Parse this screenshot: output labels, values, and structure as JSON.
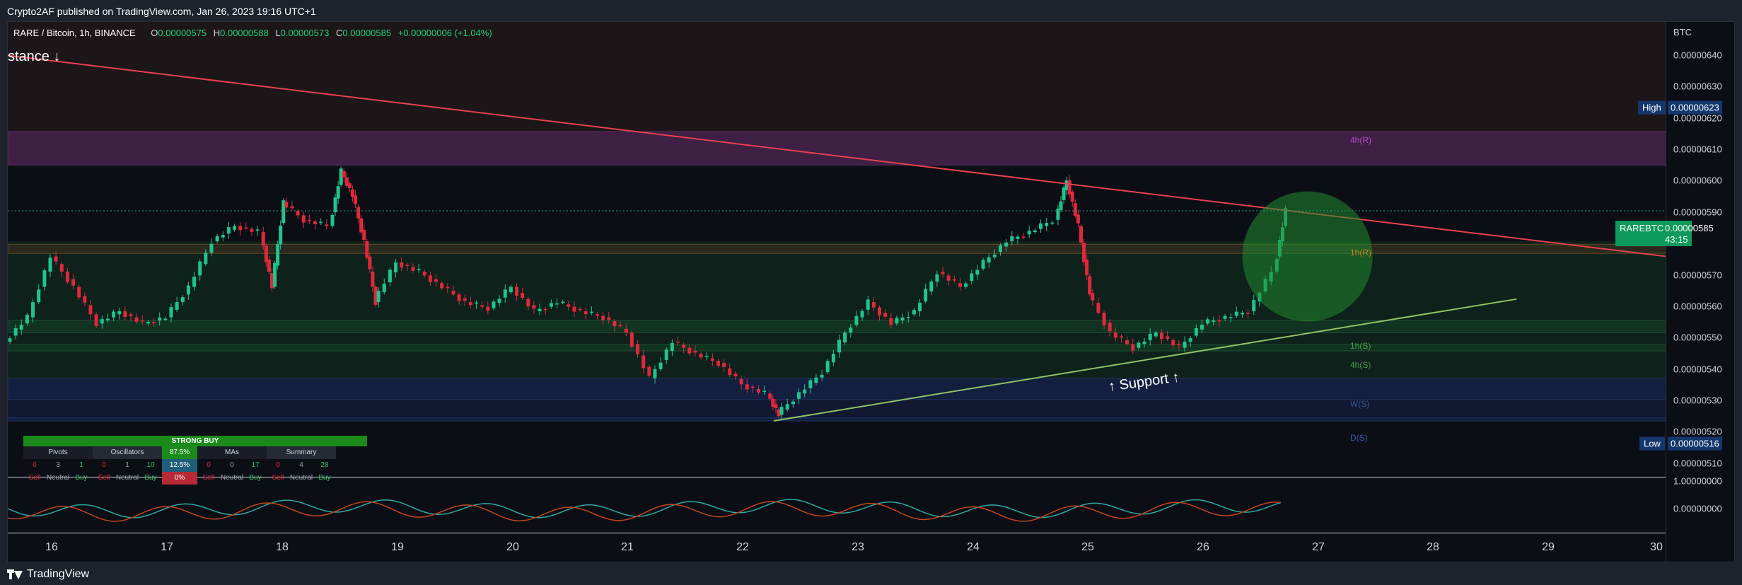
{
  "header": {
    "publisher": "Crypto2AF published on TradingView.com, Jan 26, 2023 19:16 UTC+1"
  },
  "legend": {
    "symbol": "RARE / Bitcoin, 1h, BINANCE",
    "o_label": "O",
    "o": "0.00000575",
    "h_label": "H",
    "h": "0.00000588",
    "l_label": "L",
    "l": "0.00000573",
    "c_label": "C",
    "c": "0.00000585",
    "change": "+0.00000006 (+1.04%)"
  },
  "annotations": {
    "stance": "stance ↓",
    "support": "↑ Support ↑",
    "zone_4h_r": "4h(R)",
    "zone_1h_r": "1h(R)",
    "zone_1h_s": "1h(S)",
    "zone_4h_s": "4h(S)",
    "zone_w_s": "W(S)",
    "zone_d_s": "D(S)"
  },
  "y_axis": {
    "currency": "BTC",
    "ticks": [
      "0.00000640",
      "0.00000630",
      "0.00000620",
      "0.00000610",
      "0.00000600",
      "0.00000590",
      "0.00000570",
      "0.00000560",
      "0.00000550",
      "0.00000540",
      "0.00000530",
      "0.00000520",
      "0.00000510"
    ],
    "high_label": "High",
    "high_value": "0.00000623",
    "low_label": "Low",
    "low_value": "0.00000516",
    "symbol_tag": "RAREBTC",
    "last_price": "0.00000585",
    "countdown": "43:15",
    "osc_ticks": [
      "1.00000000",
      "0.00000000"
    ]
  },
  "x_axis": {
    "ticks": [
      "16",
      "17",
      "18",
      "19",
      "20",
      "21",
      "22",
      "23",
      "24",
      "25",
      "26",
      "27",
      "28",
      "29",
      "30"
    ]
  },
  "tech_summary": {
    "header": "STRONG BUY",
    "groups": [
      {
        "title": "Pivots",
        "sell": "0",
        "neutral": "3",
        "buy": "1"
      },
      {
        "title": "Oscillators",
        "sell": "0",
        "neutral": "1",
        "buy": "10"
      },
      {
        "title": "MAs",
        "sell": "0",
        "neutral": "0",
        "buy": "17"
      },
      {
        "title": "Summary",
        "sell": "0",
        "neutral": "4",
        "buy": "28"
      }
    ],
    "sell_label": "Sell",
    "neutral_label": "Neutral",
    "buy_label": "Buy",
    "pct_buy": "87.5%",
    "pct_neutral": "12.5%",
    "pct_sell": "0%"
  },
  "footer": {
    "brand": "TradingView"
  },
  "colors": {
    "up": "#22c38e",
    "down": "#e0283c",
    "resistance_line": "#e8414e",
    "support_line": "#8fc263",
    "bg": "#0c0e15"
  },
  "chart_data": {
    "type": "line",
    "title": "",
    "xlabel": "",
    "ylabel": "BTC",
    "x_unit": "day of month (Jan 2023)",
    "xlim": [
      15.6,
      30
    ],
    "ylim": [
      5.03e-06,
      6.47e-06
    ],
    "series": [
      {
        "x": [
          15.6,
          15.8,
          16.0,
          16.2,
          16.4,
          16.6,
          16.8,
          17.0,
          17.2,
          17.4,
          17.6,
          17.8,
          17.9,
          18.0,
          18.2,
          18.4,
          18.5,
          18.6,
          18.7,
          18.8,
          19.0,
          19.2,
          19.4,
          19.6,
          19.8,
          20.0,
          20.2,
          20.4,
          20.6,
          20.8,
          21.0,
          21.2,
          21.4,
          21.6,
          21.8,
          22.0,
          22.2,
          22.3,
          22.5,
          22.7,
          22.9,
          23.1,
          23.3,
          23.5,
          23.7,
          23.9,
          24.1,
          24.3,
          24.5,
          24.7,
          24.8,
          24.9,
          25.0,
          25.2,
          25.4,
          25.6,
          25.8,
          26.0,
          26.2,
          26.4,
          26.6,
          26.7
        ],
        "y": [
          5.42e-06,
          5.5e-06,
          5.7e-06,
          5.6e-06,
          5.48e-06,
          5.52e-06,
          5.48e-06,
          5.5e-06,
          5.6e-06,
          5.75e-06,
          5.8e-06,
          5.78e-06,
          5.6e-06,
          5.88e-06,
          5.82e-06,
          5.8e-06,
          5.98e-06,
          5.9e-06,
          5.75e-06,
          5.55e-06,
          5.68e-06,
          5.65e-06,
          5.6e-06,
          5.55e-06,
          5.53e-06,
          5.6e-06,
          5.52e-06,
          5.55e-06,
          5.52e-06,
          5.5e-06,
          5.45e-06,
          5.3e-06,
          5.42e-06,
          5.38e-06,
          5.35e-06,
          5.28e-06,
          5.25e-06,
          5.18e-06,
          5.25e-06,
          5.32e-06,
          5.45e-06,
          5.55e-06,
          5.48e-06,
          5.52e-06,
          5.65e-06,
          5.6e-06,
          5.68e-06,
          5.75e-06,
          5.78e-06,
          5.82e-06,
          5.95e-06,
          5.8e-06,
          5.58e-06,
          5.45e-06,
          5.4e-06,
          5.45e-06,
          5.4e-06,
          5.48e-06,
          5.5e-06,
          5.52e-06,
          5.65e-06,
          5.85e-06
        ]
      }
    ],
    "trendlines": [
      {
        "name": "resistance",
        "x": [
          15.6,
          30
        ],
        "y": [
          6.36e-06,
          5.7e-06
        ]
      },
      {
        "name": "support",
        "x": [
          22.25,
          28.7
        ],
        "y": [
          5.16e-06,
          5.56e-06
        ]
      }
    ],
    "zones": [
      {
        "label": "4h(R)",
        "y": [
          6e-06,
          6.11e-06
        ]
      },
      {
        "label": "1h(R)",
        "y": [
          5.71e-06,
          5.74e-06
        ]
      },
      {
        "label": "1h(S)",
        "y": [
          5.45e-06,
          5.49e-06
        ]
      },
      {
        "label": "4h(S)",
        "y": [
          5.39e-06,
          5.41e-06
        ]
      },
      {
        "label": "W(S)",
        "y": [
          5.23e-06,
          5.3e-06
        ]
      },
      {
        "label": "D(S)",
        "y": [
          5.16e-06,
          5.17e-06
        ]
      }
    ],
    "grid": false
  }
}
